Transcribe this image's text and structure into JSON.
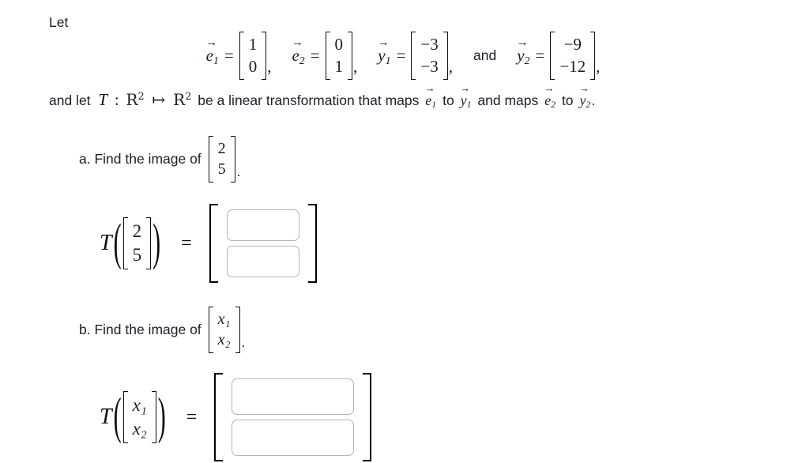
{
  "intro": {
    "let_label": "Let"
  },
  "definitions": {
    "e1": {
      "name": "e",
      "subscript": "1",
      "arrow": "⃗",
      "equals": "=",
      "entries": [
        "1",
        "0"
      ],
      "trailing": ","
    },
    "e2": {
      "name": "e",
      "subscript": "2",
      "arrow": "⃗",
      "equals": "=",
      "entries": [
        "0",
        "1"
      ],
      "trailing": ","
    },
    "y1": {
      "name": "y",
      "subscript": "1",
      "arrow": "⃗",
      "equals": "=",
      "entries": [
        "−3",
        "−3"
      ],
      "trailing": ","
    },
    "conjunction": "and",
    "y2": {
      "name": "y",
      "subscript": "2",
      "arrow": "⃗",
      "equals": "=",
      "entries": [
        "−9",
        "−12"
      ],
      "trailing": ","
    }
  },
  "transformation_sentence": {
    "part1": "and let",
    "t_symbol": "T",
    "colon": ":",
    "domain_base": "R",
    "domain_exp": "2",
    "maps_to": "↦",
    "codomain_base": "R",
    "codomain_exp": "2",
    "part2": "be a linear transformation that maps",
    "e1_name": "e",
    "e1_sub": "1",
    "to_word_1": "to",
    "y1_name": "y",
    "y1_sub": "1",
    "and_maps": "and maps",
    "e2_name": "e",
    "e2_sub": "2",
    "to_word_2": "to",
    "y2_name": "y",
    "y2_sub": "2",
    "period": "."
  },
  "part_a": {
    "prompt": "a. Find the image of",
    "vector_entries": [
      "2",
      "5"
    ],
    "period": ".",
    "answer": {
      "t_symbol": "T",
      "open_paren": "(",
      "close_paren": ")",
      "input_entries": [
        "2",
        "5"
      ],
      "equals": "=",
      "box_values": [
        "",
        ""
      ],
      "box_placeholders": [
        "",
        ""
      ]
    }
  },
  "part_b": {
    "prompt": "b. Find the image of",
    "vector_entries": [
      "x₁",
      "x₂"
    ],
    "period": ".",
    "answer": {
      "t_symbol": "T",
      "open_paren": "(",
      "close_paren": ")",
      "input_entries": [
        "x₁",
        "x₂"
      ],
      "equals": "=",
      "box_values": [
        "",
        ""
      ],
      "box_placeholders": [
        "",
        ""
      ]
    }
  },
  "colors": {
    "text": "#20202f",
    "math": "#0d0d1a",
    "input_border": "#b4b4b4",
    "bracket": "#000000",
    "background": "#ffffff"
  }
}
